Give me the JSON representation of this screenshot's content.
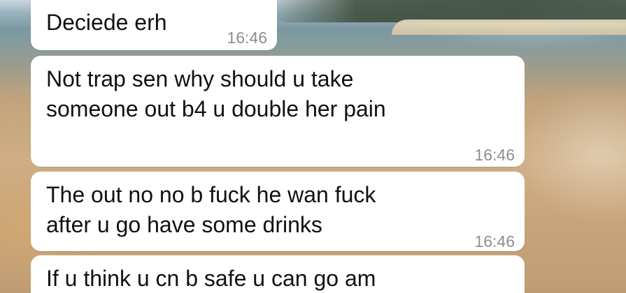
{
  "messages": [
    {
      "lines": [
        "Deciede erh"
      ],
      "time": "16:46"
    },
    {
      "lines": [
        "Not trap sen why should u take",
        "someone out b4 u double her pain"
      ],
      "time": "16:46"
    },
    {
      "lines": [
        "The out no no b fuck he wan fuck",
        "after u go have some drinks"
      ],
      "time": "16:46"
    },
    {
      "lines": [
        "If u think u cn b safe u can go am"
      ],
      "time": ""
    }
  ],
  "colors": {
    "bubble_bg": "#ffffff",
    "text": "#111111",
    "timestamp": "#8a8f93"
  }
}
